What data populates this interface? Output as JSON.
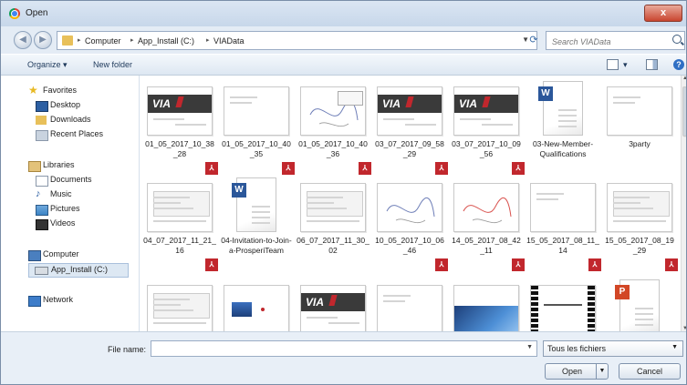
{
  "window": {
    "title": "Open",
    "close_glyph": "x"
  },
  "address": {
    "crumbs": [
      "Computer",
      "App_Install (C:)",
      "VIAData"
    ],
    "search_placeholder": "Search VIAData"
  },
  "toolbar": {
    "organize": "Organize ▾",
    "new_folder": "New folder",
    "view_dd": "▾"
  },
  "nav": {
    "favorites": "Favorites",
    "desktop": "Desktop",
    "downloads": "Downloads",
    "recent": "Recent Places",
    "libraries": "Libraries",
    "documents": "Documents",
    "music": "Music",
    "pictures": "Pictures",
    "videos": "Videos",
    "computer": "Computer",
    "drive": "App_Install (C:)",
    "network": "Network"
  },
  "files": [
    {
      "name": "01_05_2017_10_38_28",
      "kind": "pdf-via"
    },
    {
      "name": "01_05_2017_10_40_35",
      "kind": "pdf-blank"
    },
    {
      "name": "01_05_2017_10_40_36",
      "kind": "pdf-sketch"
    },
    {
      "name": "03_07_2017_09_58_29",
      "kind": "pdf-via"
    },
    {
      "name": "03_07_2017_10_09_56",
      "kind": "pdf-via"
    },
    {
      "name": "03-New-Member-Qualifications",
      "kind": "word"
    },
    {
      "name": "3party",
      "kind": "image"
    },
    {
      "name": "04_07_2017_11_21_16",
      "kind": "pdf-form"
    },
    {
      "name": "04-Invitation-to-Join-a-ProsperiTeam",
      "kind": "word"
    },
    {
      "name": "06_07_2017_11_30_02",
      "kind": "image-form"
    },
    {
      "name": "10_05_2017_10_06_46",
      "kind": "pdf-sketch2"
    },
    {
      "name": "14_05_2017_08_42_11",
      "kind": "pdf-sketch3"
    },
    {
      "name": "15_05_2017_08_11_14",
      "kind": "pdf-blank"
    },
    {
      "name": "15_05_2017_08_19_29",
      "kind": "pdf-form"
    },
    {
      "name": "",
      "kind": "form"
    },
    {
      "name": "",
      "kind": "image-blue"
    },
    {
      "name": "",
      "kind": "via"
    },
    {
      "name": "",
      "kind": "blank"
    },
    {
      "name": "",
      "kind": "image-desk"
    },
    {
      "name": "",
      "kind": "video"
    },
    {
      "name": "",
      "kind": "ppt"
    }
  ],
  "footer": {
    "file_name_label": "File name:",
    "file_name_value": "",
    "filter": "Tous les fichiers",
    "open": "Open",
    "cancel": "Cancel"
  }
}
